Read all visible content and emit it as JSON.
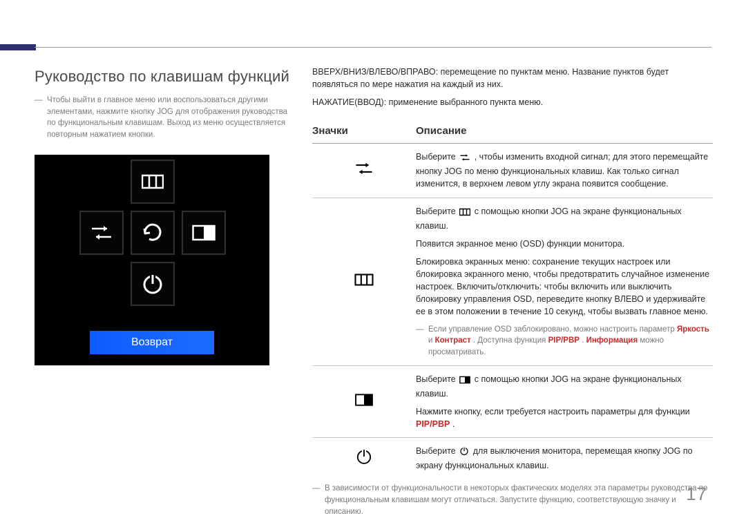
{
  "header": {
    "title": "Руководство по клавишам функций",
    "note": "Чтобы выйти в главное меню или воспользоваться другими элементами, нажмите кнопку JOG для отображения руководства по функциональным клавишам. Выход из меню осуществляется повторным нажатием кнопки."
  },
  "osd": {
    "return_label": "Возврат"
  },
  "right": {
    "para1": "ВВЕРХ/ВНИЗ/ВЛЕВО/ВПРАВО: перемещение по пунктам меню. Название пунктов будет появляться по мере нажатия на каждый из них.",
    "para2": "НАЖАТИЕ(ВВОД): применение выбранного пункта меню.",
    "table": {
      "col_icon": "Значки",
      "col_desc": "Описание"
    },
    "rows": {
      "source": {
        "pre": "Выберите ",
        "post": ", чтобы изменить входной сигнал; для этого перемещайте кнопку JOG по меню функциональных клавиш. Как только сигнал изменится, в верхнем левом углу экрана появится сообщение."
      },
      "menu": {
        "p1_pre": "Выберите ",
        "p1_post": " с помощью кнопки JOG на экране функциональных клавиш.",
        "p2": "Появится экранное меню (OSD) функции монитора.",
        "p3": "Блокировка экранных меню: сохранение текущих настроек или блокировка экранного меню, чтобы предотвратить случайное изменение настроек. Включить/отключить: чтобы включить или выключить блокировку управления OSD, переведите кнопку ВЛЕВО и удерживайте ее в этом положении в течение 10 секунд, чтобы вызвать главное меню.",
        "note_pre": "Если управление OSD заблокировано, можно настроить параметр ",
        "note_brightness": "Яркость",
        "note_and": " и ",
        "note_contrast": "Контраст",
        "note_mid": ". Доступна функция ",
        "note_pip": "PIP/PBP",
        "note_mid2": ". ",
        "note_info": "Информация",
        "note_post": " можно просматривать."
      },
      "pip": {
        "p1_pre": "Выберите ",
        "p1_post": " с помощью кнопки JOG на экране функциональных клавиш.",
        "p2_pre": "Нажмите кнопку, если требуется настроить параметры для функции ",
        "p2_pip": "PIP/PBP",
        "p2_post": "."
      },
      "power": {
        "pre": "Выберите ",
        "post": " для выключения монитора, перемещая кнопку JOG по экрану функциональных клавиш."
      }
    },
    "footer_note": "В зависимости от функциональности в некоторых фактических моделях эта параметры руководства по функциональным клавишам могут отличаться. Запустите функцию, соответствующую значку и описанию."
  },
  "page_number": "17"
}
